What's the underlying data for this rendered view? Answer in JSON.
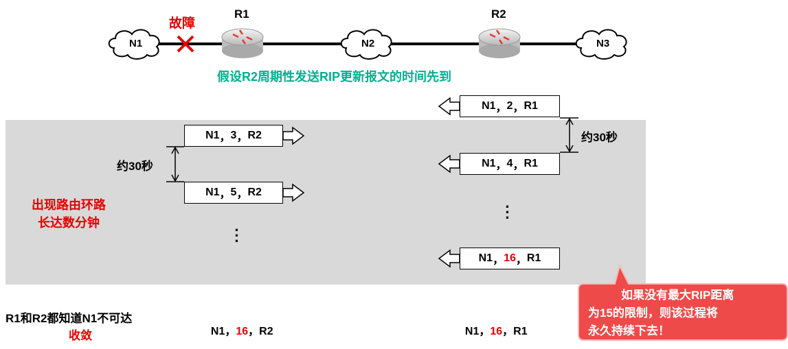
{
  "topology": {
    "networks": [
      "N1",
      "N2",
      "N3"
    ],
    "routers": [
      "R1",
      "R2"
    ],
    "fault_label": "故障"
  },
  "assumption_text": "假设R2周期性发送RIP更新报文的时间先到",
  "left_messages": [
    {
      "net": "N1",
      "dist": "3",
      "next": "R2"
    },
    {
      "net": "N1",
      "dist": "5",
      "next": "R2"
    }
  ],
  "right_messages": [
    {
      "net": "N1",
      "dist": "2",
      "next": "R1"
    },
    {
      "net": "N1",
      "dist": "4",
      "next": "R1"
    },
    {
      "net": "N1",
      "dist": "16",
      "next": "R1"
    }
  ],
  "interval_left": "约30秒",
  "interval_right": "约30秒",
  "loop_text": [
    "出现路由环路",
    "长达数分钟"
  ],
  "final": {
    "line1": "R1和R2都知道N1不可达",
    "line2": "收敛",
    "left_entry": {
      "net": "N1",
      "dist": "16",
      "next": "R2"
    },
    "right_entry": {
      "net": "N1",
      "dist": "16",
      "next": "R1"
    }
  },
  "callout": {
    "lines": [
      "如果没有最大RIP距离",
      "为15的限制，则该过程将",
      "永久持续下去！"
    ]
  },
  "separator": "，",
  "colors": {
    "red": "#e60000",
    "teal": "#00b08f",
    "callout": "#ef4a4a",
    "band": "#d9d9d9"
  }
}
